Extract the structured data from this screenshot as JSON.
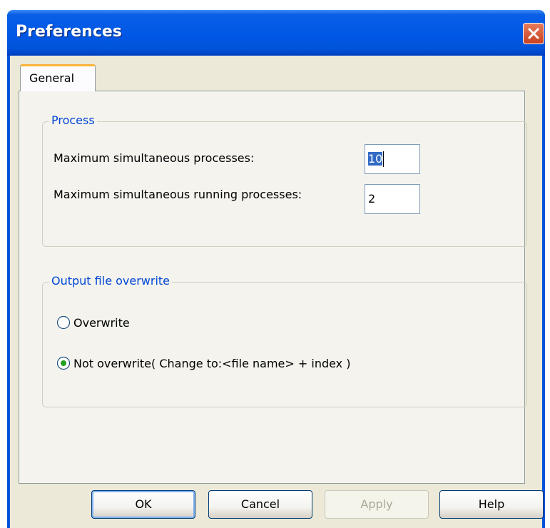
{
  "window": {
    "title": "Preferences"
  },
  "tabs": [
    {
      "label": "General",
      "active": true
    }
  ],
  "process_group": {
    "legend": "Process",
    "max_processes_label": "Maximum simultaneous processes:",
    "max_processes_value": "10",
    "max_running_label": "Maximum simultaneous running processes:",
    "max_running_value": "2"
  },
  "overwrite_group": {
    "legend": "Output file overwrite",
    "options": [
      {
        "label": "Overwrite",
        "selected": false
      },
      {
        "label": "Not overwrite( Change to:<file name> + index )",
        "selected": true
      }
    ]
  },
  "buttons": {
    "ok": "OK",
    "cancel": "Cancel",
    "apply": "Apply",
    "help": "Help"
  },
  "colors": {
    "title_bar": "#0058e6",
    "legend_text": "#0046d5",
    "tab_highlight": "#f9b23a",
    "close_button": "#d9582f"
  }
}
